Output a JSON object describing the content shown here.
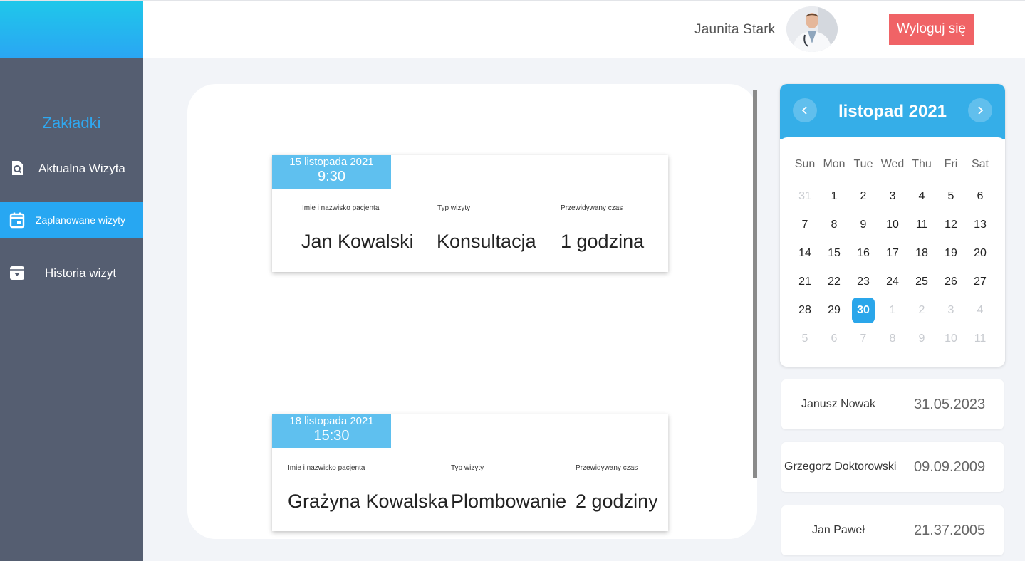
{
  "header": {
    "user_name": "Jaunita Stark",
    "logout_label": "Wyloguj się"
  },
  "sidebar": {
    "heading": "Zakładki",
    "items": [
      {
        "label": "Aktualna Wizyta",
        "icon": "search-document-icon"
      },
      {
        "label": "Zaplanowane wizyty",
        "icon": "calendar-icon",
        "active": true
      },
      {
        "label": "Historia wizyt",
        "icon": "archive-download-icon"
      }
    ]
  },
  "visits": [
    {
      "date": "15 listopada 2021",
      "time": "9:30",
      "patient_header": "Imie i nazwisko pacjenta",
      "type_header": "Typ wizyty",
      "duration_header": "Przewidywany czas",
      "patient": "Jan Kowalski",
      "type": "Konsultacja",
      "duration": "1 godzina"
    },
    {
      "date": "18 listopada 2021",
      "time": "15:30",
      "patient_header": "Imie i nazwisko pacjenta",
      "type_header": "Typ wizyty",
      "duration_header": "Przewidywany czas",
      "patient": "Grażyna Kowalska",
      "type": "Plombowanie",
      "duration": "2 godziny"
    }
  ],
  "calendar": {
    "title": "listopad 2021",
    "weekdays": [
      "Sun",
      "Mon",
      "Tue",
      "Wed",
      "Thu",
      "Fri",
      "Sat"
    ],
    "selected_day": "30",
    "weeks": [
      [
        "31",
        "1",
        "2",
        "3",
        "4",
        "5",
        "6"
      ],
      [
        "7",
        "8",
        "9",
        "10",
        "11",
        "12",
        "13"
      ],
      [
        "14",
        "15",
        "16",
        "17",
        "18",
        "19",
        "20"
      ],
      [
        "21",
        "22",
        "23",
        "24",
        "25",
        "26",
        "27"
      ],
      [
        "28",
        "29",
        "30",
        "1",
        "2",
        "3",
        "4"
      ],
      [
        "5",
        "6",
        "7",
        "8",
        "9",
        "10",
        "11"
      ]
    ]
  },
  "patients": [
    {
      "name": "Janusz Nowak",
      "date": "31.05.2023"
    },
    {
      "name": "Grzegorz Doktorowski",
      "date": "09.09.2009"
    },
    {
      "name": "Jan Paweł",
      "date": "21.37.2005"
    }
  ]
}
